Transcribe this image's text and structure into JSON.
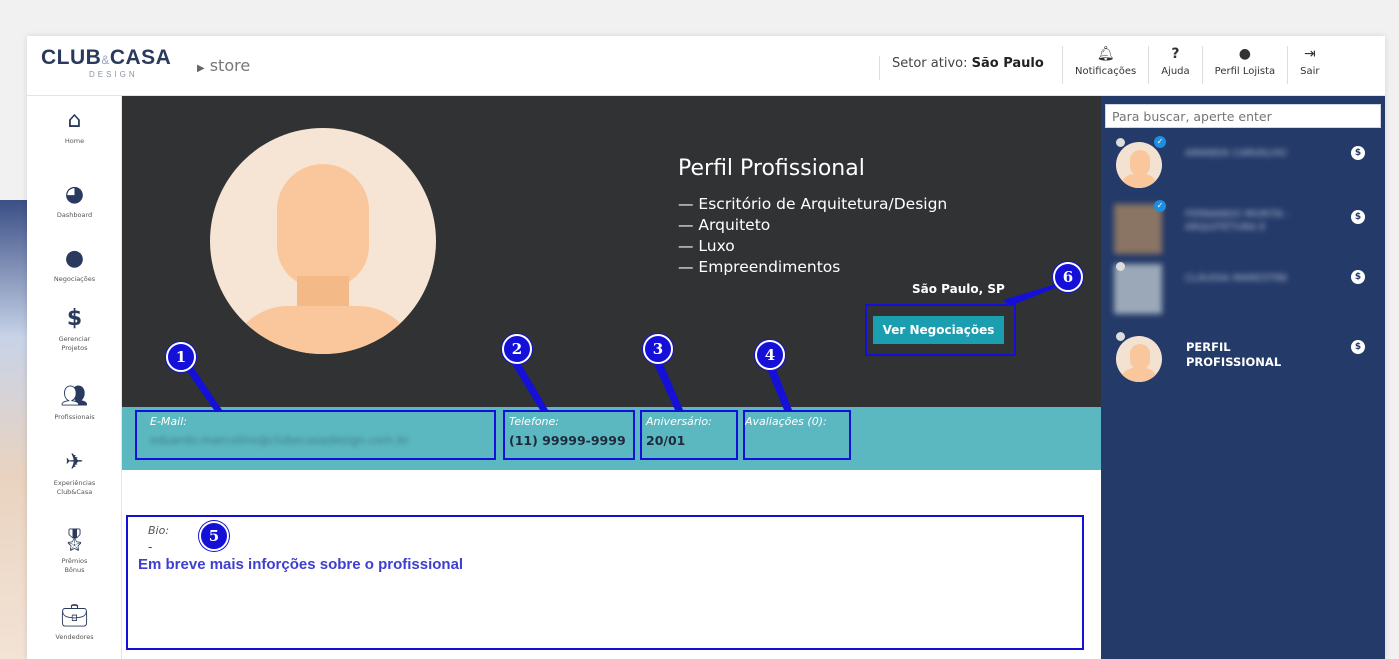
{
  "header": {
    "logo_main": "CLUB",
    "logo_amp": "&",
    "logo_main2": "CASA",
    "logo_sub": "DESIGN",
    "store_label": "store",
    "setor_label": "Setor ativo:",
    "setor_value": "São Paulo",
    "nav": [
      {
        "label": "Notificações",
        "icon": "bell-icon"
      },
      {
        "label": "Ajuda",
        "icon": "question-icon"
      },
      {
        "label": "Perfil Lojista",
        "icon": "user-icon"
      },
      {
        "label": "Sair",
        "icon": "logout-icon"
      }
    ]
  },
  "sidebar": {
    "items": [
      {
        "label": "Home",
        "icon": "home-icon"
      },
      {
        "label": "Dashboard",
        "icon": "pie-chart-icon"
      },
      {
        "label": "Negociações",
        "icon": "money-bubble-icon"
      },
      {
        "label": "Gerenciar\nProjetos",
        "icon": "dollar-icon"
      },
      {
        "label": "Profissionais",
        "icon": "users-icon"
      },
      {
        "label": "Experiências\nClub&Casa",
        "icon": "plane-icon"
      },
      {
        "label": "Prêmios\nBônus",
        "icon": "award-icon"
      },
      {
        "label": "Vendedores",
        "icon": "briefcase-icon"
      }
    ]
  },
  "profile": {
    "title": "Perfil Profissional",
    "tags": [
      "— Escritório de Arquitetura/Design",
      "— Arquiteto",
      "— Luxo",
      "— Empreendimentos"
    ],
    "location": "São Paulo, SP",
    "cta_label": "Ver Negociações"
  },
  "info": {
    "email_label": "E-Mail:",
    "email_value": "eduardo.marcolino@clubecasadesign.com.br",
    "phone_label": "Telefone:",
    "phone_value": "(11) 99999-9999",
    "birthday_label": "Aniversário:",
    "birthday_value": "20/01",
    "reviews_label": "Avaliações (0):"
  },
  "bio": {
    "label": "Bio:",
    "value": "-",
    "note": "Em breve mais inforções sobre o profissional"
  },
  "right_panel": {
    "search_placeholder": "Para buscar, aperte enter",
    "contacts": [
      {
        "name": "AMANDA CARVALHO",
        "blurred": true
      },
      {
        "name": "FERNANDO MORITA - ARQUITETURA E",
        "blurred": true
      },
      {
        "name": "CLÁUDIA MARESTINI",
        "blurred": true
      },
      {
        "name": "PERFIL PROFISSIONAL",
        "blurred": false
      }
    ]
  },
  "annotations": [
    "1",
    "2",
    "3",
    "4",
    "5",
    "6"
  ],
  "colors": {
    "hero_bg": "#303233",
    "info_bg": "#5cb8c0",
    "panel_bg": "#243a69",
    "cta_bg": "#1a9eb0",
    "annotation": "#1410d8"
  }
}
